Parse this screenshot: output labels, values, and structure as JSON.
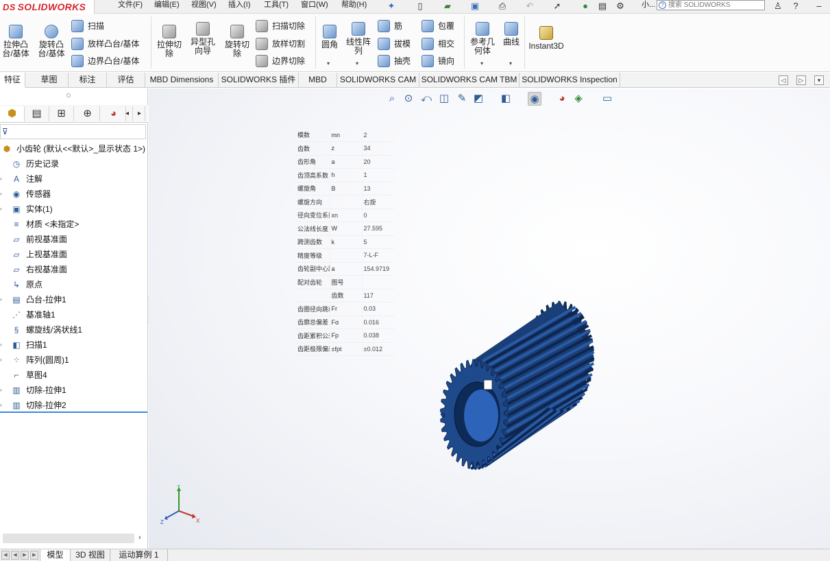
{
  "app": {
    "logo_text": "SOLIDWORKS",
    "logo_prefix": "DS"
  },
  "menu": {
    "items": [
      "文件(F)",
      "编辑(E)",
      "视图(V)",
      "插入(I)",
      "工具(T)",
      "窗口(W)",
      "帮助(H)"
    ],
    "user_short": "小...",
    "search_placeholder": "搜索 SOLIDWORKS"
  },
  "ribbon": {
    "extrude_boss": "拉伸凸\n台/基体",
    "revolve_boss": "旋转凸\n台/基体",
    "sweep": "扫描",
    "loft_boss": "放样凸台/基体",
    "boundary_boss": "边界凸台/基体",
    "extrude_cut": "拉伸切\n除",
    "hole_wizard": "异型孔\n向导",
    "revolve_cut": "旋转切\n除",
    "swept_cut": "扫描切除",
    "lofted_cut": "放样切割",
    "boundary_cut": "边界切除",
    "fillet": "圆角",
    "linear_pattern": "线性阵\n列",
    "rib": "筋",
    "draft": "拔模",
    "shell": "抽壳",
    "wrap": "包覆",
    "intersect": "相交",
    "mirror": "镜向",
    "ref_geometry": "参考几\n何体",
    "curves": "曲线",
    "instant3d": "Instant3D"
  },
  "tabs": [
    "特征",
    "草图",
    "标注",
    "评估",
    "MBD Dimensions",
    "SOLIDWORKS 插件",
    "MBD",
    "SOLIDWORKS CAM",
    "SOLIDWORKS CAM TBM",
    "SOLIDWORKS Inspection"
  ],
  "filter_glyph": "⊽",
  "tree": [
    {
      "label": "小齿轮  (默认<<默认>_显示状态 1>)",
      "icon": "part-icon",
      "glyph": "⬢"
    },
    {
      "label": "历史记录",
      "icon": "history-icon",
      "glyph": "◷"
    },
    {
      "label": "注解",
      "icon": "annotations-icon",
      "glyph": "A"
    },
    {
      "label": "传感器",
      "icon": "sensors-icon",
      "glyph": "◉"
    },
    {
      "label": "实体(1)",
      "icon": "solid-bodies-icon",
      "glyph": "▣"
    },
    {
      "label": "材质 <未指定>",
      "icon": "material-icon",
      "glyph": "≡"
    },
    {
      "label": "前视基准面",
      "icon": "plane-icon",
      "glyph": "▱"
    },
    {
      "label": "上视基准面",
      "icon": "plane-icon",
      "glyph": "▱"
    },
    {
      "label": "右视基准面",
      "icon": "plane-icon",
      "glyph": "▱"
    },
    {
      "label": "原点",
      "icon": "origin-icon",
      "glyph": "↳"
    },
    {
      "label": "凸台-拉伸1",
      "icon": "boss-extrude-icon",
      "glyph": "▤"
    },
    {
      "label": "基准轴1",
      "icon": "axis-icon",
      "glyph": "⋰"
    },
    {
      "label": "螺旋线/涡状线1",
      "icon": "helix-icon",
      "glyph": "§"
    },
    {
      "label": "扫描1",
      "icon": "sweep-icon",
      "glyph": "◧"
    },
    {
      "label": "阵列(圆周)1",
      "icon": "circular-pattern-icon",
      "glyph": "⁘"
    },
    {
      "label": "草图4",
      "icon": "sketch-icon",
      "glyph": "⌐"
    },
    {
      "label": "切除-拉伸1",
      "icon": "cut-extrude-icon",
      "glyph": "▥"
    },
    {
      "label": "切除-拉伸2",
      "icon": "cut-extrude-icon",
      "glyph": "▥"
    }
  ],
  "param_table": [
    [
      "模数",
      "mn",
      "2"
    ],
    [
      "齿数",
      "z",
      "34"
    ],
    [
      "齿形角",
      "a",
      "20"
    ],
    [
      "齿顶高系数",
      "h",
      "1"
    ],
    [
      "螺旋角",
      "B",
      "13"
    ],
    [
      "螺旋方向",
      "",
      "右旋"
    ],
    [
      "径向变位系数",
      "xn",
      "0"
    ],
    [
      "公法线长度",
      "W",
      "27.595"
    ],
    [
      "跨测齿数",
      "k",
      "5"
    ],
    [
      "精度等级",
      "",
      "7-L-F"
    ],
    [
      "齿轮副中心距",
      "a",
      "154.9719"
    ],
    [
      "配对齿轮",
      "图号",
      ""
    ],
    [
      "",
      "齿数",
      "117"
    ],
    [
      "齿圈径向跳动",
      "Fr",
      "0.03"
    ],
    [
      "齿廓总偏差",
      "Fα",
      "0.016"
    ],
    [
      "齿距累积公差",
      "Fp",
      "0.038"
    ],
    [
      "齿距极限偏差",
      "±fpt",
      "±0.012"
    ]
  ],
  "triad": {
    "x": "X",
    "y": "Y",
    "z": "Z"
  },
  "bottom_tabs": [
    "模型",
    "3D 视图",
    "运动算例 1"
  ],
  "colors": {
    "gear": "#1e4a8c",
    "tree_end_line": "#3d88d8",
    "accent": "#d7262e"
  }
}
